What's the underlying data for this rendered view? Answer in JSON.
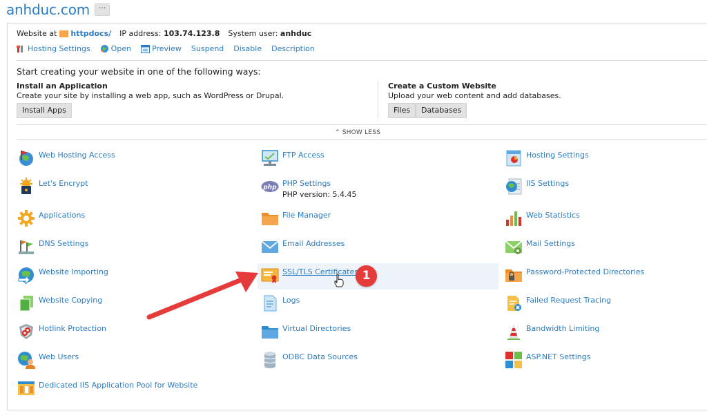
{
  "header": {
    "domain": "anhduc.com",
    "more_label": "···"
  },
  "info": {
    "website_at_label": "Website at",
    "folder_link": "httpdocs/",
    "ip_label": "IP address:",
    "ip_value": "103.74.123.8",
    "user_label": "System user:",
    "user_value": "anhduc"
  },
  "actions": {
    "hosting_settings": "Hosting Settings",
    "open": "Open",
    "preview": "Preview",
    "suspend": "Suspend",
    "disable": "Disable",
    "description": "Description"
  },
  "start": {
    "heading": "Start creating your website in one of the following ways:",
    "app_title": "Install an Application",
    "app_desc": "Create your site by installing a web app, such as WordPress or Drupal.",
    "install_apps": "Install Apps",
    "custom_title": "Create a Custom Website",
    "custom_desc": "Upload your web content and add databases.",
    "files": "Files",
    "databases": "Databases"
  },
  "show_less": "SHOW LESS",
  "tools": {
    "col1": [
      {
        "label": "Web Hosting Access",
        "icon": "globe-flag-icon"
      },
      {
        "label": "Let's Encrypt",
        "icon": "padlock-sun-icon"
      },
      {
        "label": "Applications",
        "icon": "gear-icon"
      },
      {
        "label": "DNS Settings",
        "icon": "dns-flags-icon"
      },
      {
        "label": "Website Importing",
        "icon": "globe-arrow-icon"
      },
      {
        "label": "Website Copying",
        "icon": "copy-pages-icon"
      },
      {
        "label": "Hotlink Protection",
        "icon": "shield-link-icon"
      },
      {
        "label": "Web Users",
        "icon": "globe-user-icon"
      },
      {
        "label": "Dedicated IIS Application Pool for Website",
        "icon": "app-pool-icon"
      }
    ],
    "col2": [
      {
        "label": "FTP Access",
        "icon": "ftp-monitor-icon"
      },
      {
        "label": "PHP Settings",
        "sub": "PHP version: 5.4.45",
        "icon": "php-icon"
      },
      {
        "label": "File Manager",
        "icon": "folder-icon"
      },
      {
        "label": "Email Addresses",
        "icon": "envelope-icon"
      },
      {
        "label": "SSL/TLS Certificates",
        "icon": "certificate-icon"
      },
      {
        "label": "Logs",
        "icon": "log-file-icon"
      },
      {
        "label": "Virtual Directories",
        "icon": "folder-blue-icon"
      },
      {
        "label": "ODBC Data Sources",
        "icon": "database-icon"
      }
    ],
    "col3": [
      {
        "label": "Hosting Settings",
        "icon": "hosting-doc-icon"
      },
      {
        "label": "IIS Settings",
        "icon": "globe-settings-icon"
      },
      {
        "label": "Web Statistics",
        "icon": "bar-chart-icon"
      },
      {
        "label": "Mail Settings",
        "icon": "mail-settings-icon"
      },
      {
        "label": "Password-Protected Directories",
        "icon": "locked-folder-icon"
      },
      {
        "label": "Failed Request Tracing",
        "icon": "failed-trace-icon"
      },
      {
        "label": "Bandwidth Limiting",
        "icon": "bandwidth-icon"
      },
      {
        "label": "ASP.NET Settings",
        "icon": "aspnet-icon"
      }
    ]
  },
  "annotation": {
    "badge": "1"
  },
  "colors": {
    "link": "#2b7cc1",
    "badge": "#e53b3b",
    "arrow": "#e53b3b",
    "highlight": "#eef3fa"
  }
}
